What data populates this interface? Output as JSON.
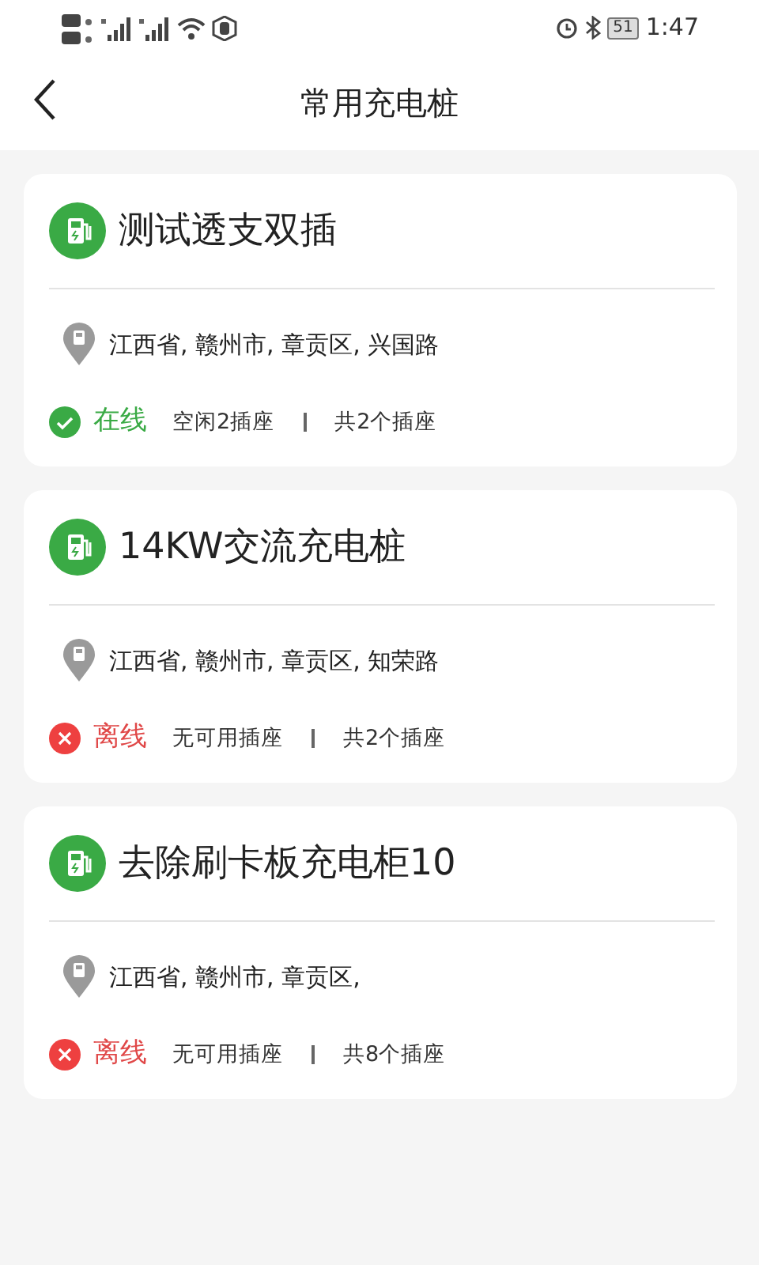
{
  "status_bar": {
    "battery": "51",
    "time": "1:47"
  },
  "header": {
    "title": "常用充电桩"
  },
  "stations": [
    {
      "name": "测试透支双插",
      "address": "江西省, 赣州市, 章贡区, 兴国路",
      "status": {
        "kind": "online",
        "label": "在线"
      },
      "free": "空闲2插座",
      "total": "共2个插座"
    },
    {
      "name": "14KW交流充电桩",
      "address": "江西省, 赣州市, 章贡区, 知荣路",
      "status": {
        "kind": "offline",
        "label": "离线"
      },
      "free": "无可用插座",
      "total": "共2个插座"
    },
    {
      "name": "去除刷卡板充电柜10",
      "address": "江西省, 赣州市, 章贡区,",
      "status": {
        "kind": "offline",
        "label": "离线"
      },
      "free": "无可用插座",
      "total": "共8个插座"
    }
  ]
}
